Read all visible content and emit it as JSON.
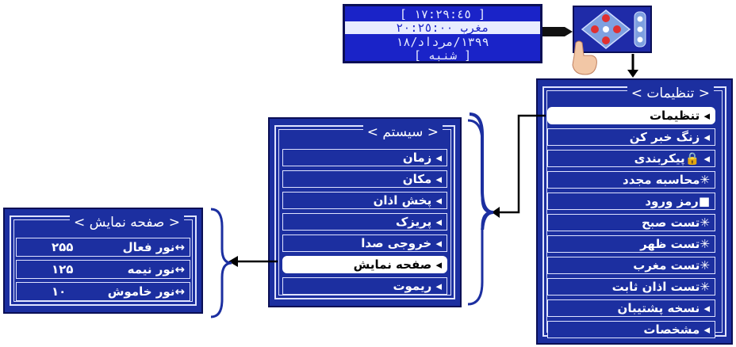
{
  "lcd": {
    "row1": "[ ١٧:٢٩:٤٥ ]",
    "row2": "مغرب ٢٠:٢٥:٠٠",
    "row3": "١٣٩٩/مرداد/١٨",
    "row4": "[ شنبه ]"
  },
  "settings": {
    "title": "< تنظیمات >",
    "items": [
      "◂ تنظیمات",
      "◂ زنگ خبر کن",
      "◂ 🔒پیکربندی",
      "✳محاسبه مجدد",
      "■رمز ورود",
      "✳تست صبح",
      "✳تست ظهر",
      "✳تست مغرب",
      "✳تست اذان ثابت",
      "◂ نسخه پشتیبان",
      "◂ مشخصات"
    ]
  },
  "system": {
    "title": "< سیستم >",
    "items": [
      "◂ زمان",
      "◂ مکان",
      "◂ پخش اذان",
      "◂ پریزک",
      "◂ خروجی صدا",
      "◂ صفحه نمایش",
      "◂ ریموت"
    ]
  },
  "display": {
    "title": "< صفحه نمایش >",
    "items": [
      {
        "label": "↔نور فعال",
        "value": "٢۵۵"
      },
      {
        "label": "↔نور نیمه",
        "value": "١٢۵"
      },
      {
        "label": "↔نور خاموش",
        "value": "١٠"
      }
    ]
  },
  "colors": {
    "panel": "#1c2fa0",
    "border": "#0a0f55",
    "line": "#dfe3ff",
    "selected": "#ffffff"
  }
}
